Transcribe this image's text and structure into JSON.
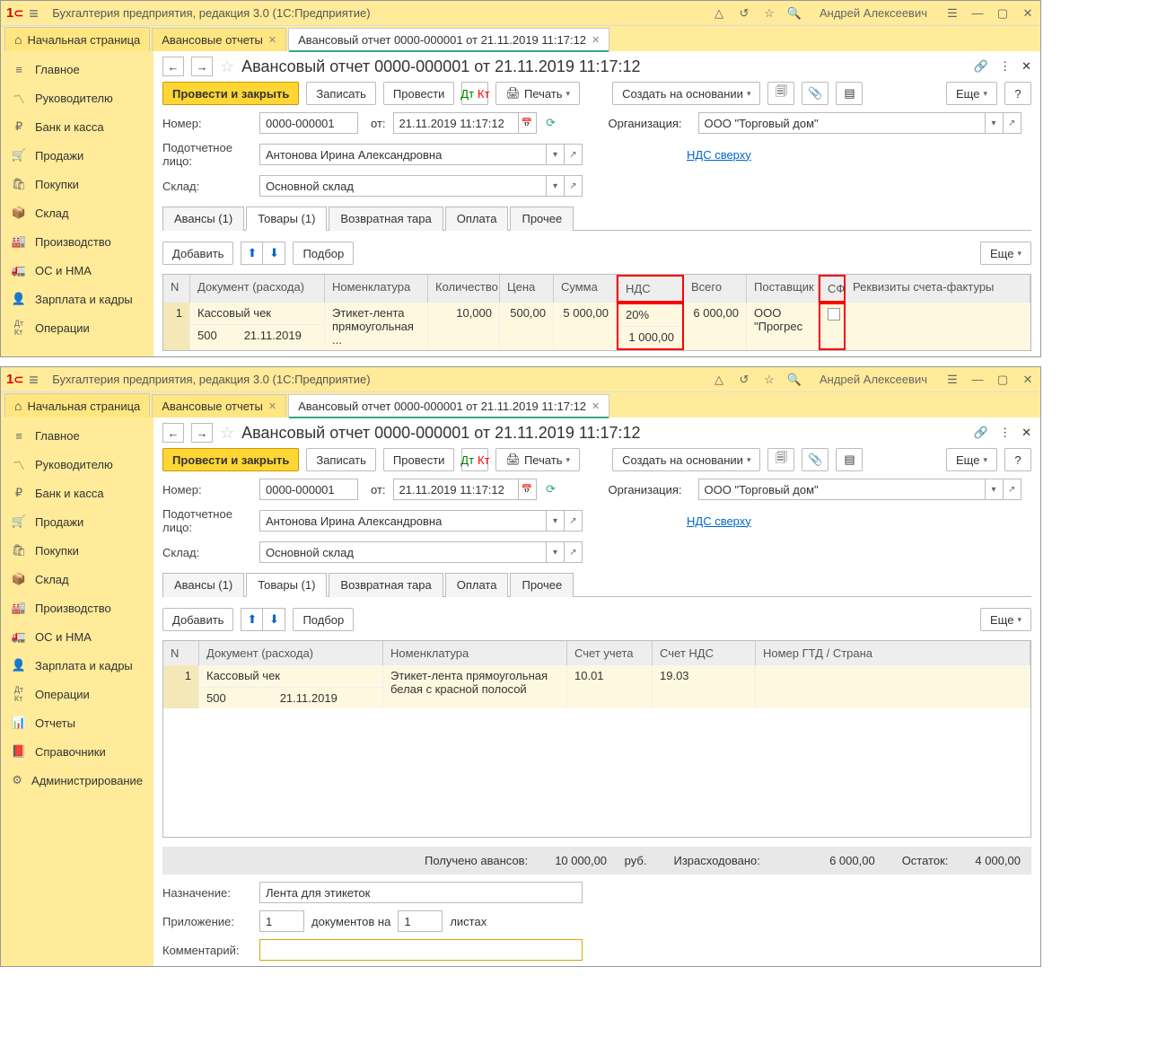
{
  "app": {
    "title": "Бухгалтерия предприятия, редакция 3.0  (1С:Предприятие)",
    "user": "Андрей Алексеевич"
  },
  "main_tabs": {
    "home": "Начальная страница",
    "t1": "Авансовые отчеты",
    "t2": "Авансовый отчет 0000-000001 от 21.11.2019 11:17:12"
  },
  "nav": {
    "main": "Главное",
    "manager": "Руководителю",
    "bank": "Банк и касса",
    "sales": "Продажи",
    "purchases": "Покупки",
    "warehouse": "Склад",
    "production": "Производство",
    "os": "ОС и НМА",
    "salary": "Зарплата и кадры",
    "ops": "Операции",
    "reports": "Отчеты",
    "refs": "Справочники",
    "admin": "Администрирование"
  },
  "doc": {
    "title": "Авансовый отчет 0000-000001 от 21.11.2019 11:17:12",
    "btn_post_close": "Провести и закрыть",
    "btn_save": "Записать",
    "btn_post": "Провести",
    "btn_print": "Печать",
    "btn_create_based": "Создать на основании",
    "btn_more": "Еще",
    "lbl_number": "Номер:",
    "val_number": "0000-000001",
    "lbl_from": "от:",
    "val_date": "21.11.2019 11:17:12",
    "lbl_org": "Организация:",
    "val_org": "ООО \"Торговый дом\"",
    "lbl_person": "Подотчетное лицо:",
    "val_person": "Антонова Ирина Александровна",
    "link_vat": "НДС сверху",
    "lbl_warehouse": "Склад:",
    "val_warehouse": "Основной склад"
  },
  "subtabs": {
    "advances": "Авансы (1)",
    "goods": "Товары (1)",
    "tare": "Возвратная тара",
    "payment": "Оплата",
    "other": "Прочее"
  },
  "tabbar": {
    "add": "Добавить",
    "select": "Подбор",
    "more": "Еще"
  },
  "table1": {
    "h_n": "N",
    "h_doc": "Документ (расхода)",
    "h_nom": "Номенклатура",
    "h_qty": "Количество",
    "h_price": "Цена",
    "h_sum": "Сумма",
    "h_vat": "НДС",
    "h_total": "Всего",
    "h_supplier": "Поставщик",
    "h_sf": "СФ",
    "h_sfreq": "Реквизиты счета-фактуры",
    "r_n": "1",
    "r_doc1": "Кассовый чек",
    "r_doc2a": "500",
    "r_doc2b": "21.11.2019",
    "r_nom": "Этикет-лента прямоугольная ...",
    "r_qty": "10,000",
    "r_price": "500,00",
    "r_sum": "5 000,00",
    "r_vat1": "20%",
    "r_vat2": "1 000,00",
    "r_total": "6 000,00",
    "r_supplier": "ООО \"Прогрес"
  },
  "table2": {
    "h_n": "N",
    "h_doc": "Документ (расхода)",
    "h_nom": "Номенклатура",
    "h_acc": "Счет учета",
    "h_vatacc": "Счет НДС",
    "h_gtd": "Номер ГТД / Страна",
    "r_n": "1",
    "r_doc1": "Кассовый чек",
    "r_doc2a": "500",
    "r_doc2b": "21.11.2019",
    "r_nom": "Этикет-лента прямоугольная белая с красной полосой",
    "r_acc": "10.01",
    "r_vatacc": "19.03"
  },
  "totals": {
    "lbl_received": "Получено авансов:",
    "val_received": "10 000,00",
    "rub": "руб.",
    "lbl_spent": "Израсходовано:",
    "val_spent": "6 000,00",
    "lbl_remain": "Остаток:",
    "val_remain": "4 000,00"
  },
  "footer": {
    "lbl_purpose": "Назначение:",
    "val_purpose": "Лента для этикеток",
    "lbl_attach": "Приложение:",
    "val_docs": "1",
    "txt_docs": "документов на",
    "val_sheets": "1",
    "txt_sheets": "листах",
    "lbl_comment": "Комментарий:"
  }
}
